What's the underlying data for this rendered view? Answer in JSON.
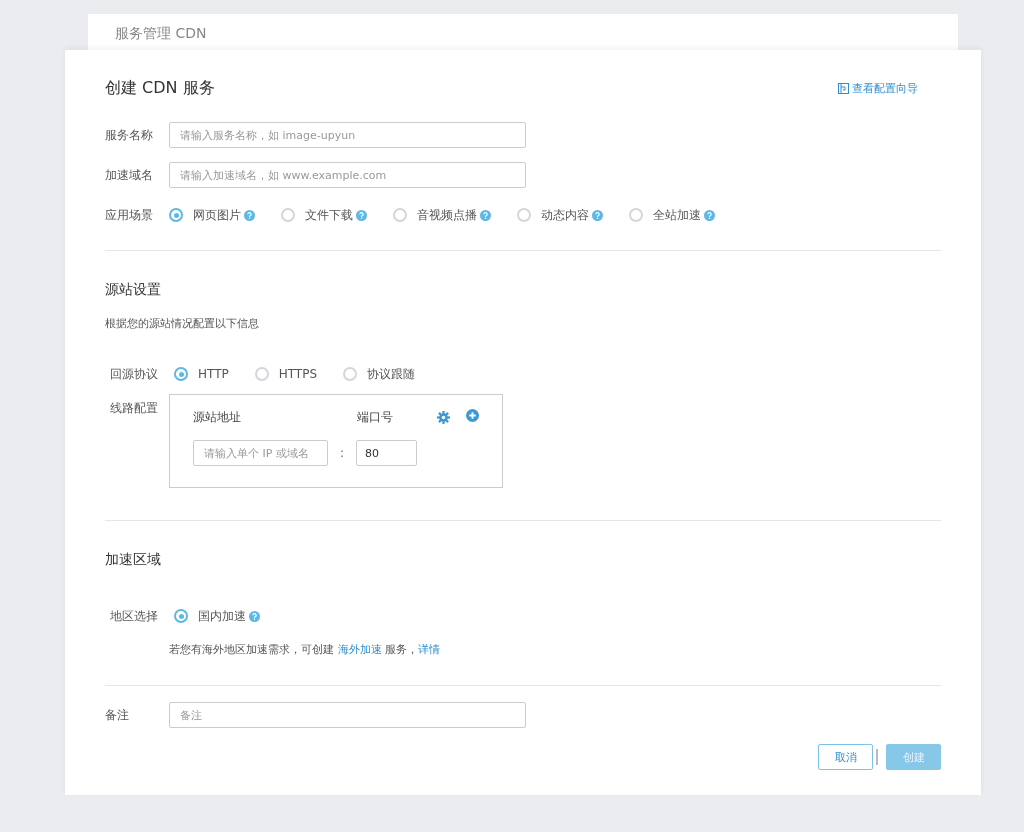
{
  "breadcrumb": "服务管理 CDN",
  "form": {
    "title": "创建 CDN 服务",
    "guide_link": "查看配置向导",
    "service_name": {
      "label": "服务名称",
      "placeholder": "请输入服务名称，如 image-upyun"
    },
    "domain": {
      "label": "加速域名",
      "placeholder": "请输入加速域名，如 www.example.com"
    },
    "scenario": {
      "label": "应用场景",
      "options": [
        {
          "label": "网页图片",
          "selected": true
        },
        {
          "label": "文件下载",
          "selected": false
        },
        {
          "label": "音视频点播",
          "selected": false
        },
        {
          "label": "动态内容",
          "selected": false
        },
        {
          "label": "全站加速",
          "selected": false
        }
      ]
    }
  },
  "origin": {
    "title": "源站设置",
    "description": "根据您的源站情况配置以下信息",
    "protocol": {
      "label": "回源协议",
      "options": [
        {
          "label": "HTTP",
          "selected": true
        },
        {
          "label": "HTTPS",
          "selected": false
        },
        {
          "label": "协议跟随",
          "selected": false
        }
      ]
    },
    "lines": {
      "label": "线路配置",
      "address_header": "源站地址",
      "port_header": "端口号",
      "address_placeholder": "请输入单个 IP 或域名",
      "separator": ":",
      "port_value": "80"
    }
  },
  "region": {
    "title": "加速区域",
    "label": "地区选择",
    "options": [
      {
        "label": "国内加速",
        "selected": true
      }
    ],
    "note": {
      "before": "若您有海外地区加速需求，可创建",
      "link": "海外加速",
      "after": "服务，",
      "link2": "详情"
    }
  },
  "remark": {
    "label": "备注",
    "placeholder": "备注"
  },
  "buttons": {
    "cancel": {
      "label": "取消"
    },
    "create": {
      "label": "创建",
      "disabled": true
    }
  }
}
